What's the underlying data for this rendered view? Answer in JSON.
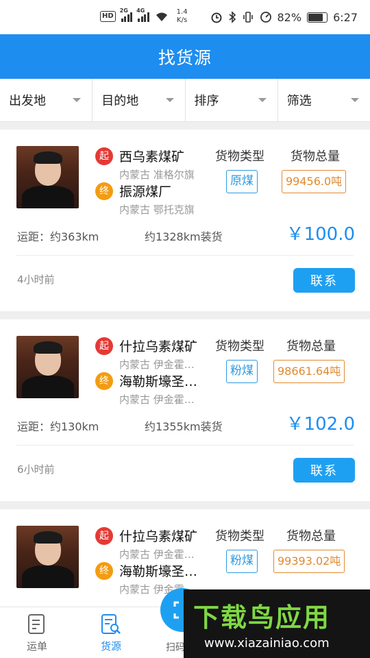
{
  "status_bar": {
    "hd_label": "HD",
    "net_1": "2G",
    "net_2": "4G",
    "speed_value": "1.4",
    "speed_unit": "K/s",
    "battery": "82%",
    "time": "6:27"
  },
  "header": {
    "title": "找货源"
  },
  "filters": [
    {
      "label": "出发地"
    },
    {
      "label": "目的地"
    },
    {
      "label": "排序"
    },
    {
      "label": "筛选"
    }
  ],
  "cards": [
    {
      "start_badge": "起",
      "end_badge": "终",
      "origin_name": "西乌素煤矿",
      "origin_region": "内蒙古 准格尔旗",
      "dest_name": "振源煤厂",
      "dest_region": "内蒙古 鄂托克旗",
      "type_label": "货物类型",
      "weight_label": "货物总量",
      "cargo_type": "原煤",
      "cargo_weight": "99456.0吨",
      "distance": "运距：约363km",
      "load_distance": "约1328km装货",
      "price": "￥100.0",
      "time_ago": "4小时前",
      "contact_label": "联系"
    },
    {
      "start_badge": "起",
      "end_badge": "终",
      "origin_name": "什拉乌素煤矿",
      "origin_region": "内蒙古 伊金霍…",
      "dest_name": "海勒斯壕圣…",
      "dest_region": "内蒙古 伊金霍…",
      "type_label": "货物类型",
      "weight_label": "货物总量",
      "cargo_type": "粉煤",
      "cargo_weight": "98661.64吨",
      "distance": "运距：约130km",
      "load_distance": "约1355km装货",
      "price": "￥102.0",
      "time_ago": "6小时前",
      "contact_label": "联系"
    },
    {
      "start_badge": "起",
      "end_badge": "终",
      "origin_name": "什拉乌素煤矿",
      "origin_region": "内蒙古 伊金霍…",
      "dest_name": "海勒斯壕圣…",
      "dest_region": "内蒙古 伊金霍…",
      "type_label": "货物类型",
      "weight_label": "货物总量",
      "cargo_type": "粉煤",
      "cargo_weight": "99393.02吨",
      "distance": "",
      "load_distance": "",
      "price": "",
      "time_ago": "",
      "contact_label": ""
    }
  ],
  "bottom_nav": {
    "items": [
      {
        "label": "运单",
        "icon": "waybill-icon"
      },
      {
        "label": "货源",
        "icon": "cargo-search-icon"
      },
      {
        "label": "扫码",
        "icon": "scan-icon"
      }
    ]
  },
  "watermark": {
    "title": "下载鸟应用",
    "url": "www.xiazainiao.com"
  },
  "colors": {
    "primary": "#1e8df0",
    "start_badge": "#e53935",
    "end_badge": "#f39c12",
    "weight_tag": "#e08a2e",
    "watermark_green": "#7fd843"
  }
}
